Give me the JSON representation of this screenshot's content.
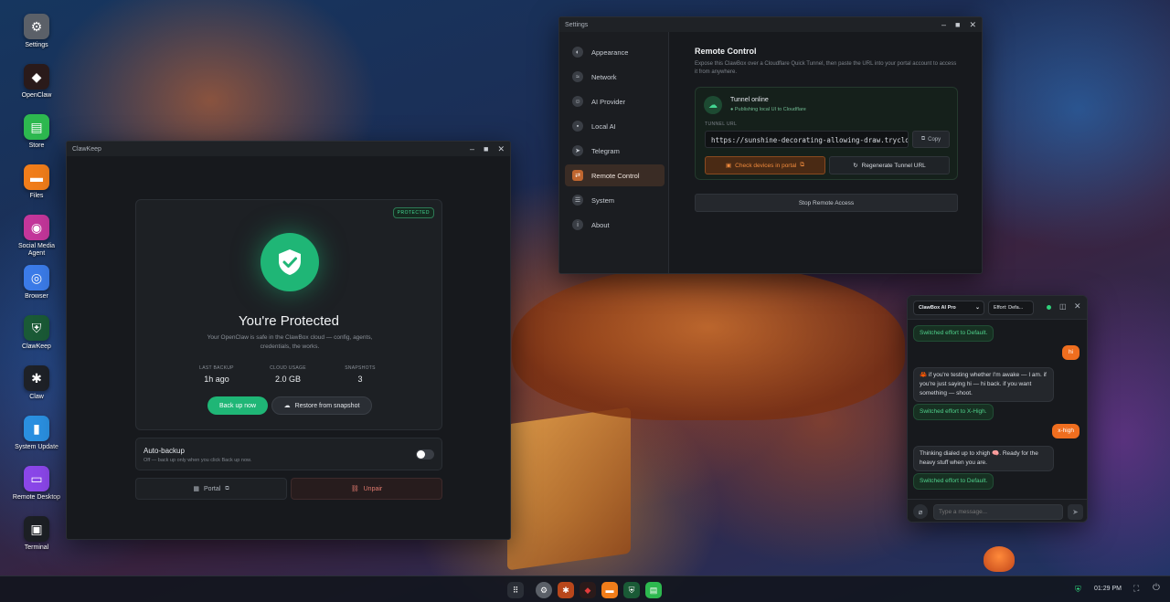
{
  "desktop": {
    "icons": [
      {
        "label": "Settings",
        "icon": "gear-icon",
        "color": "#5b6068",
        "glyph": "⚙"
      },
      {
        "label": "OpenClaw",
        "icon": "openclaw-icon",
        "color": "#2a1a1a",
        "glyph": "◆"
      },
      {
        "label": "Store",
        "icon": "store-icon",
        "color": "#2db84f",
        "glyph": "▤"
      },
      {
        "label": "Files",
        "icon": "folder-icon",
        "color": "#f07d1a",
        "glyph": "▬"
      },
      {
        "label": "Social Media Agent",
        "icon": "social-media-agent-icon",
        "color": "#c3369a",
        "glyph": "◉"
      },
      {
        "label": "Browser",
        "icon": "browser-icon",
        "color": "#3b7be8",
        "glyph": "◎"
      },
      {
        "label": "ClawKeep",
        "icon": "clawkeep-shield-icon",
        "color": "#1a5a36",
        "glyph": "⛨"
      },
      {
        "label": "Claw",
        "icon": "claw-icon",
        "color": "#1e2127",
        "glyph": "✱"
      },
      {
        "label": "System Update",
        "icon": "system-update-icon",
        "color": "#2a8fe0",
        "glyph": "▮"
      },
      {
        "label": "Remote Desktop",
        "icon": "remote-desktop-icon",
        "color": "#8a46e8",
        "glyph": "▭"
      },
      {
        "label": "Terminal",
        "icon": "terminal-icon",
        "color": "#1c1f24",
        "glyph": "▣"
      }
    ]
  },
  "clawkeep": {
    "title": "ClawKeep",
    "badge": "PROTECTED",
    "heading": "You're Protected",
    "description": "Your OpenClaw is safe in the ClawBox cloud — config, agents, credentials, the works.",
    "stats": [
      {
        "label": "LAST BACKUP",
        "value": "1h ago"
      },
      {
        "label": "CLOUD USAGE",
        "value": "2.0 GB"
      },
      {
        "label": "SNAPSHOTS",
        "value": "3"
      }
    ],
    "backup_label": "Back up now",
    "restore_label": "Restore from snapshot",
    "autobackup_title": "Auto-backup",
    "autobackup_desc": "Off — back up only when you click Back up now.",
    "autobackup_on": false,
    "portal_label": "Portal",
    "unpair_label": "Unpair"
  },
  "settings": {
    "title": "Settings",
    "nav": [
      "Appearance",
      "Network",
      "AI Provider",
      "Local AI",
      "Telegram",
      "Remote Control",
      "System",
      "About"
    ],
    "active": "Remote Control",
    "heading": "Remote Control",
    "description": "Expose this ClawBox over a Cloudflare Quick Tunnel, then paste the URL into your portal account to access it from anywhere.",
    "tunnel_status": "Tunnel online",
    "tunnel_sub": "● Publishing local UI to Cloudflare",
    "url_label": "TUNNEL URL",
    "url": "https://sunshine-decorating-allowing-draw.trycloudflare.com",
    "copy_label": "Copy",
    "check_label": "Check devices in portal",
    "regen_label": "Regenerate Tunnel URL",
    "stop_label": "Stop Remote Access"
  },
  "chat": {
    "model": "ClawBox AI Pro",
    "effort": "Effort: Defa...",
    "messages": [
      {
        "role": "system",
        "text": "Switched effort to Default."
      },
      {
        "role": "user",
        "text": "hi"
      },
      {
        "role": "bot",
        "text": "🦀 if you're testing whether I'm awake — I am. if you're just saying hi — hi back. if you want something — shoot."
      },
      {
        "role": "system",
        "text": "Switched effort to X-High."
      },
      {
        "role": "user",
        "text": "x-high"
      },
      {
        "role": "bot",
        "text": "Thinking dialed up to xhigh 🧠. Ready for the heavy stuff when you are."
      },
      {
        "role": "system",
        "text": "Switched effort to Default."
      }
    ],
    "placeholder": "Type a message..."
  },
  "taskbar": {
    "time": "01:29 PM"
  },
  "colors": {
    "accent_green": "#1fb676",
    "accent_orange": "#ef6e1f"
  }
}
